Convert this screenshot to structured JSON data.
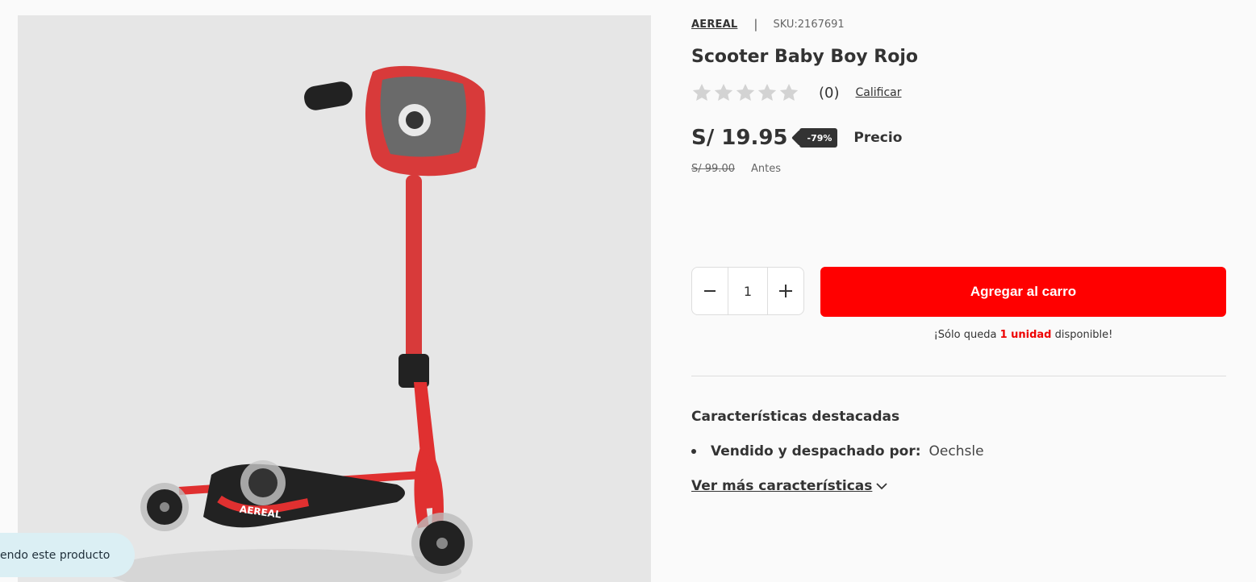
{
  "product": {
    "brand": "AEREAL",
    "sku_label": "SKU:2167691",
    "title": "Scooter Baby Boy Rojo",
    "rating_count": "(0)",
    "rate_link": "Calificar",
    "rating_value": 0,
    "rating_max": 5,
    "price": "S/ 19.95",
    "discount": "-79%",
    "price_label": "Precio",
    "old_price": "S/ 99.00",
    "old_price_label": "Antes",
    "image_logo_text": "AEREAL"
  },
  "cart": {
    "minus_icon": "minus-icon",
    "plus_icon": "plus-icon",
    "quantity": "1",
    "add_label": "Agregar al carro",
    "stock_prefix": "¡Sólo queda ",
    "stock_highlight": "1 unidad",
    "stock_suffix": " disponible!"
  },
  "features": {
    "heading": "Características destacadas",
    "items": [
      {
        "key": "Vendido y despachado por:",
        "value": "Oechsle"
      }
    ],
    "more_link": "Ver más características"
  },
  "viewing": {
    "text": "endo este producto"
  },
  "colors": {
    "accent": "#ff0000",
    "star_empty": "#d3d3d3",
    "badge_bg": "#333333",
    "pill_bg": "#dbeff4"
  }
}
